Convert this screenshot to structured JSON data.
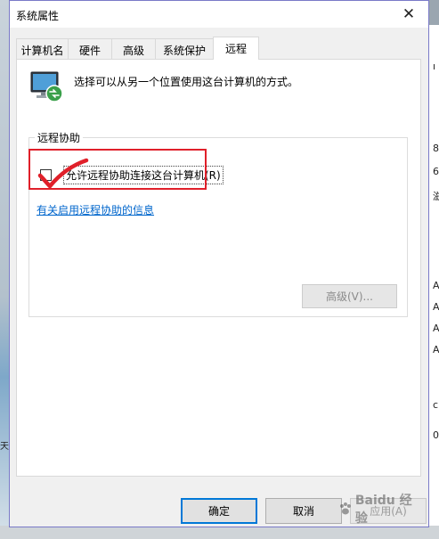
{
  "window": {
    "title": "系统属性",
    "close_glyph": "✕"
  },
  "tabs": [
    {
      "label": "计算机名"
    },
    {
      "label": "硬件"
    },
    {
      "label": "高级"
    },
    {
      "label": "系统保护"
    },
    {
      "label": "远程"
    }
  ],
  "remote_tab": {
    "description": "选择可以从另一个位置使用这台计算机的方式。",
    "group_title": "远程协助",
    "checkbox_label": "允许远程协助连接这台计算机(R)",
    "checkbox_checked": false,
    "info_link": "有关启用远程协助的信息",
    "advanced_button": "高级(V)..."
  },
  "buttons": {
    "ok": "确定",
    "cancel": "取消",
    "apply": "应用(A)"
  },
  "annotation": {
    "highlight_color": "#e0202a",
    "checkmark_color": "#e0202a"
  },
  "watermark": {
    "text": "Baidu 经验"
  },
  "background_glyphs": {
    "left": [
      "天"
    ],
    "right": [
      "ı",
      "8",
      "6",
      "滋",
      "A",
      "A",
      "A",
      "A",
      "c",
      "0"
    ]
  }
}
